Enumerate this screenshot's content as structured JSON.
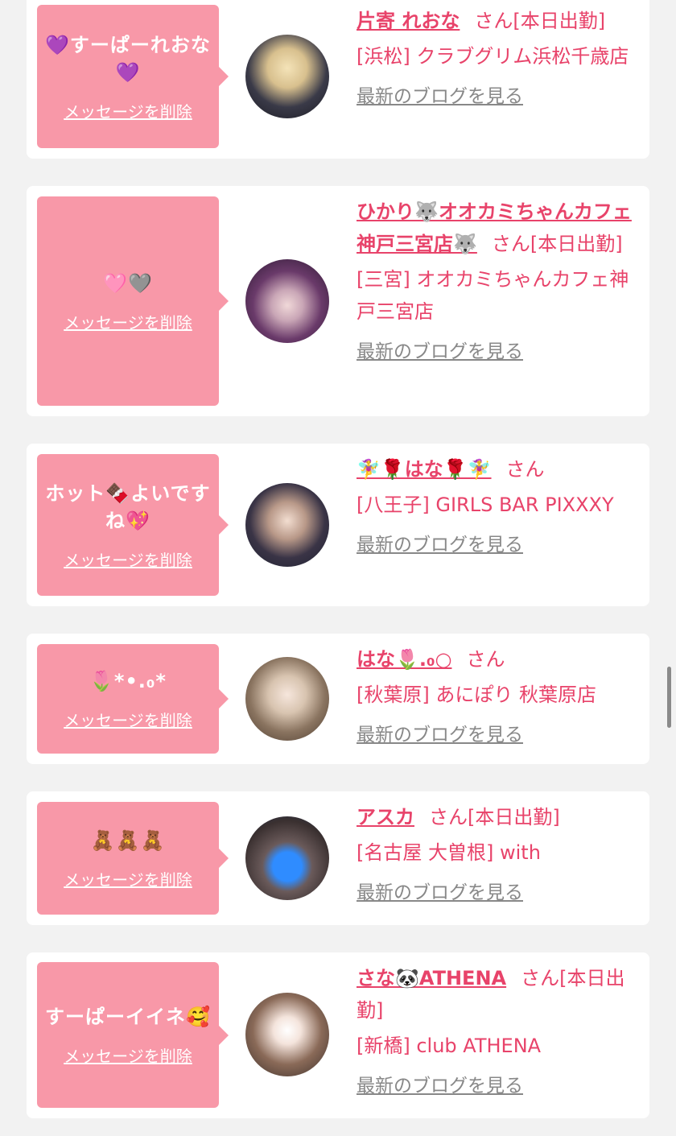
{
  "cards": [
    {
      "message": "💜すーぱーれおな💜",
      "delete_label": "メッセージを削除",
      "name": "片寄 れおな",
      "suffix": "さん[本日出勤]",
      "shop": "[浜松] クラブグリム浜松千歳店",
      "blog_label": "最新のブログを見る"
    },
    {
      "message": "🩷🩶",
      "delete_label": "メッセージを削除",
      "name": "ひかり🐺オオカミちゃんカフェ神戸三宮店🐺",
      "suffix": "さん[本日出勤]",
      "shop": "[三宮] オオカミちゃんカフェ神戸三宮店",
      "blog_label": "最新のブログを見る"
    },
    {
      "message": "ホット🍫よいですね💖",
      "delete_label": "メッセージを削除",
      "name": "🧚‍♀️🌹はな🌹🧚‍♀️",
      "suffix": "さん",
      "shop": "[八王子] GIRLS BAR PIXXXY",
      "blog_label": "最新のブログを見る"
    },
    {
      "message": "🌷*•.₀*",
      "delete_label": "メッセージを削除",
      "name": "はな🌷.₀○",
      "suffix": "さん",
      "shop": "[秋葉原] あにぽり 秋葉原店",
      "blog_label": "最新のブログを見る"
    },
    {
      "message": "🧸🧸🧸",
      "delete_label": "メッセージを削除",
      "name": "アスカ",
      "suffix": "さん[本日出勤]",
      "shop": "[名古屋 大曽根] with",
      "blog_label": "最新のブログを見る"
    },
    {
      "message": "すーぱーイイネ🥰",
      "delete_label": "メッセージを削除",
      "name": "さな🐼ATHENA",
      "suffix": "さん[本日出勤]",
      "shop": "[新橋] club ATHENA",
      "blog_label": "最新のブログを見る"
    }
  ]
}
